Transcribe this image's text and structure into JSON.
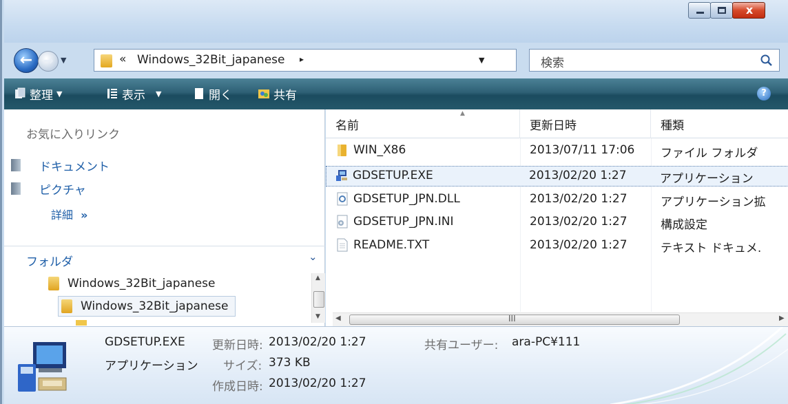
{
  "window": {
    "close_glyph": "x"
  },
  "address": {
    "chevron": "«",
    "path": "Windows_32Bit_japanese",
    "arrow": "▸"
  },
  "search": {
    "placeholder": "検索"
  },
  "toolbar": {
    "organize": "整理",
    "views": "表示",
    "open": "開く",
    "share": "共有",
    "help": "?"
  },
  "sidebar": {
    "favorites_title": "お気に入りリンク",
    "favorites": [
      {
        "label": "ドキュメント",
        "icon": "documents-icon"
      },
      {
        "label": "ピクチャ",
        "icon": "pictures-icon"
      }
    ],
    "more_label": "詳細",
    "more_glyph": "»",
    "folders_title": "フォルダ",
    "tree": [
      {
        "label": "Windows_32Bit_japanese"
      },
      {
        "label": "Windows_32Bit_japanese"
      }
    ]
  },
  "columns": {
    "name": "名前",
    "modified": "更新日時",
    "type": "種類"
  },
  "files": [
    {
      "name": "WIN_X86",
      "modified": "2013/07/11 17:06",
      "type": "ファイル フォルダ",
      "icon": "folder-icon"
    },
    {
      "name": "GDSETUP.EXE",
      "modified": "2013/02/20 1:27",
      "type": "アプリケーション",
      "icon": "application-icon"
    },
    {
      "name": "GDSETUP_JPN.DLL",
      "modified": "2013/02/20 1:27",
      "type": "アプリケーション拡",
      "icon": "dll-icon"
    },
    {
      "name": "GDSETUP_JPN.INI",
      "modified": "2013/02/20 1:27",
      "type": "構成設定",
      "icon": "ini-icon"
    },
    {
      "name": "README.TXT",
      "modified": "2013/02/20 1:27",
      "type": "テキスト ドキュメ.",
      "icon": "text-file-icon"
    }
  ],
  "hscroll_grip": "III",
  "details": {
    "file_name": "GDSETUP.EXE",
    "file_type": "アプリケーション",
    "modified_label": "更新日時:",
    "modified_value": "2013/02/20 1:27",
    "size_label": "サイズ:",
    "size_value": "373 KB",
    "created_label": "作成日時:",
    "created_value": "2013/02/20 1:27",
    "shared_label": "共有ユーザー:",
    "shared_value": "ara-PC¥111"
  }
}
